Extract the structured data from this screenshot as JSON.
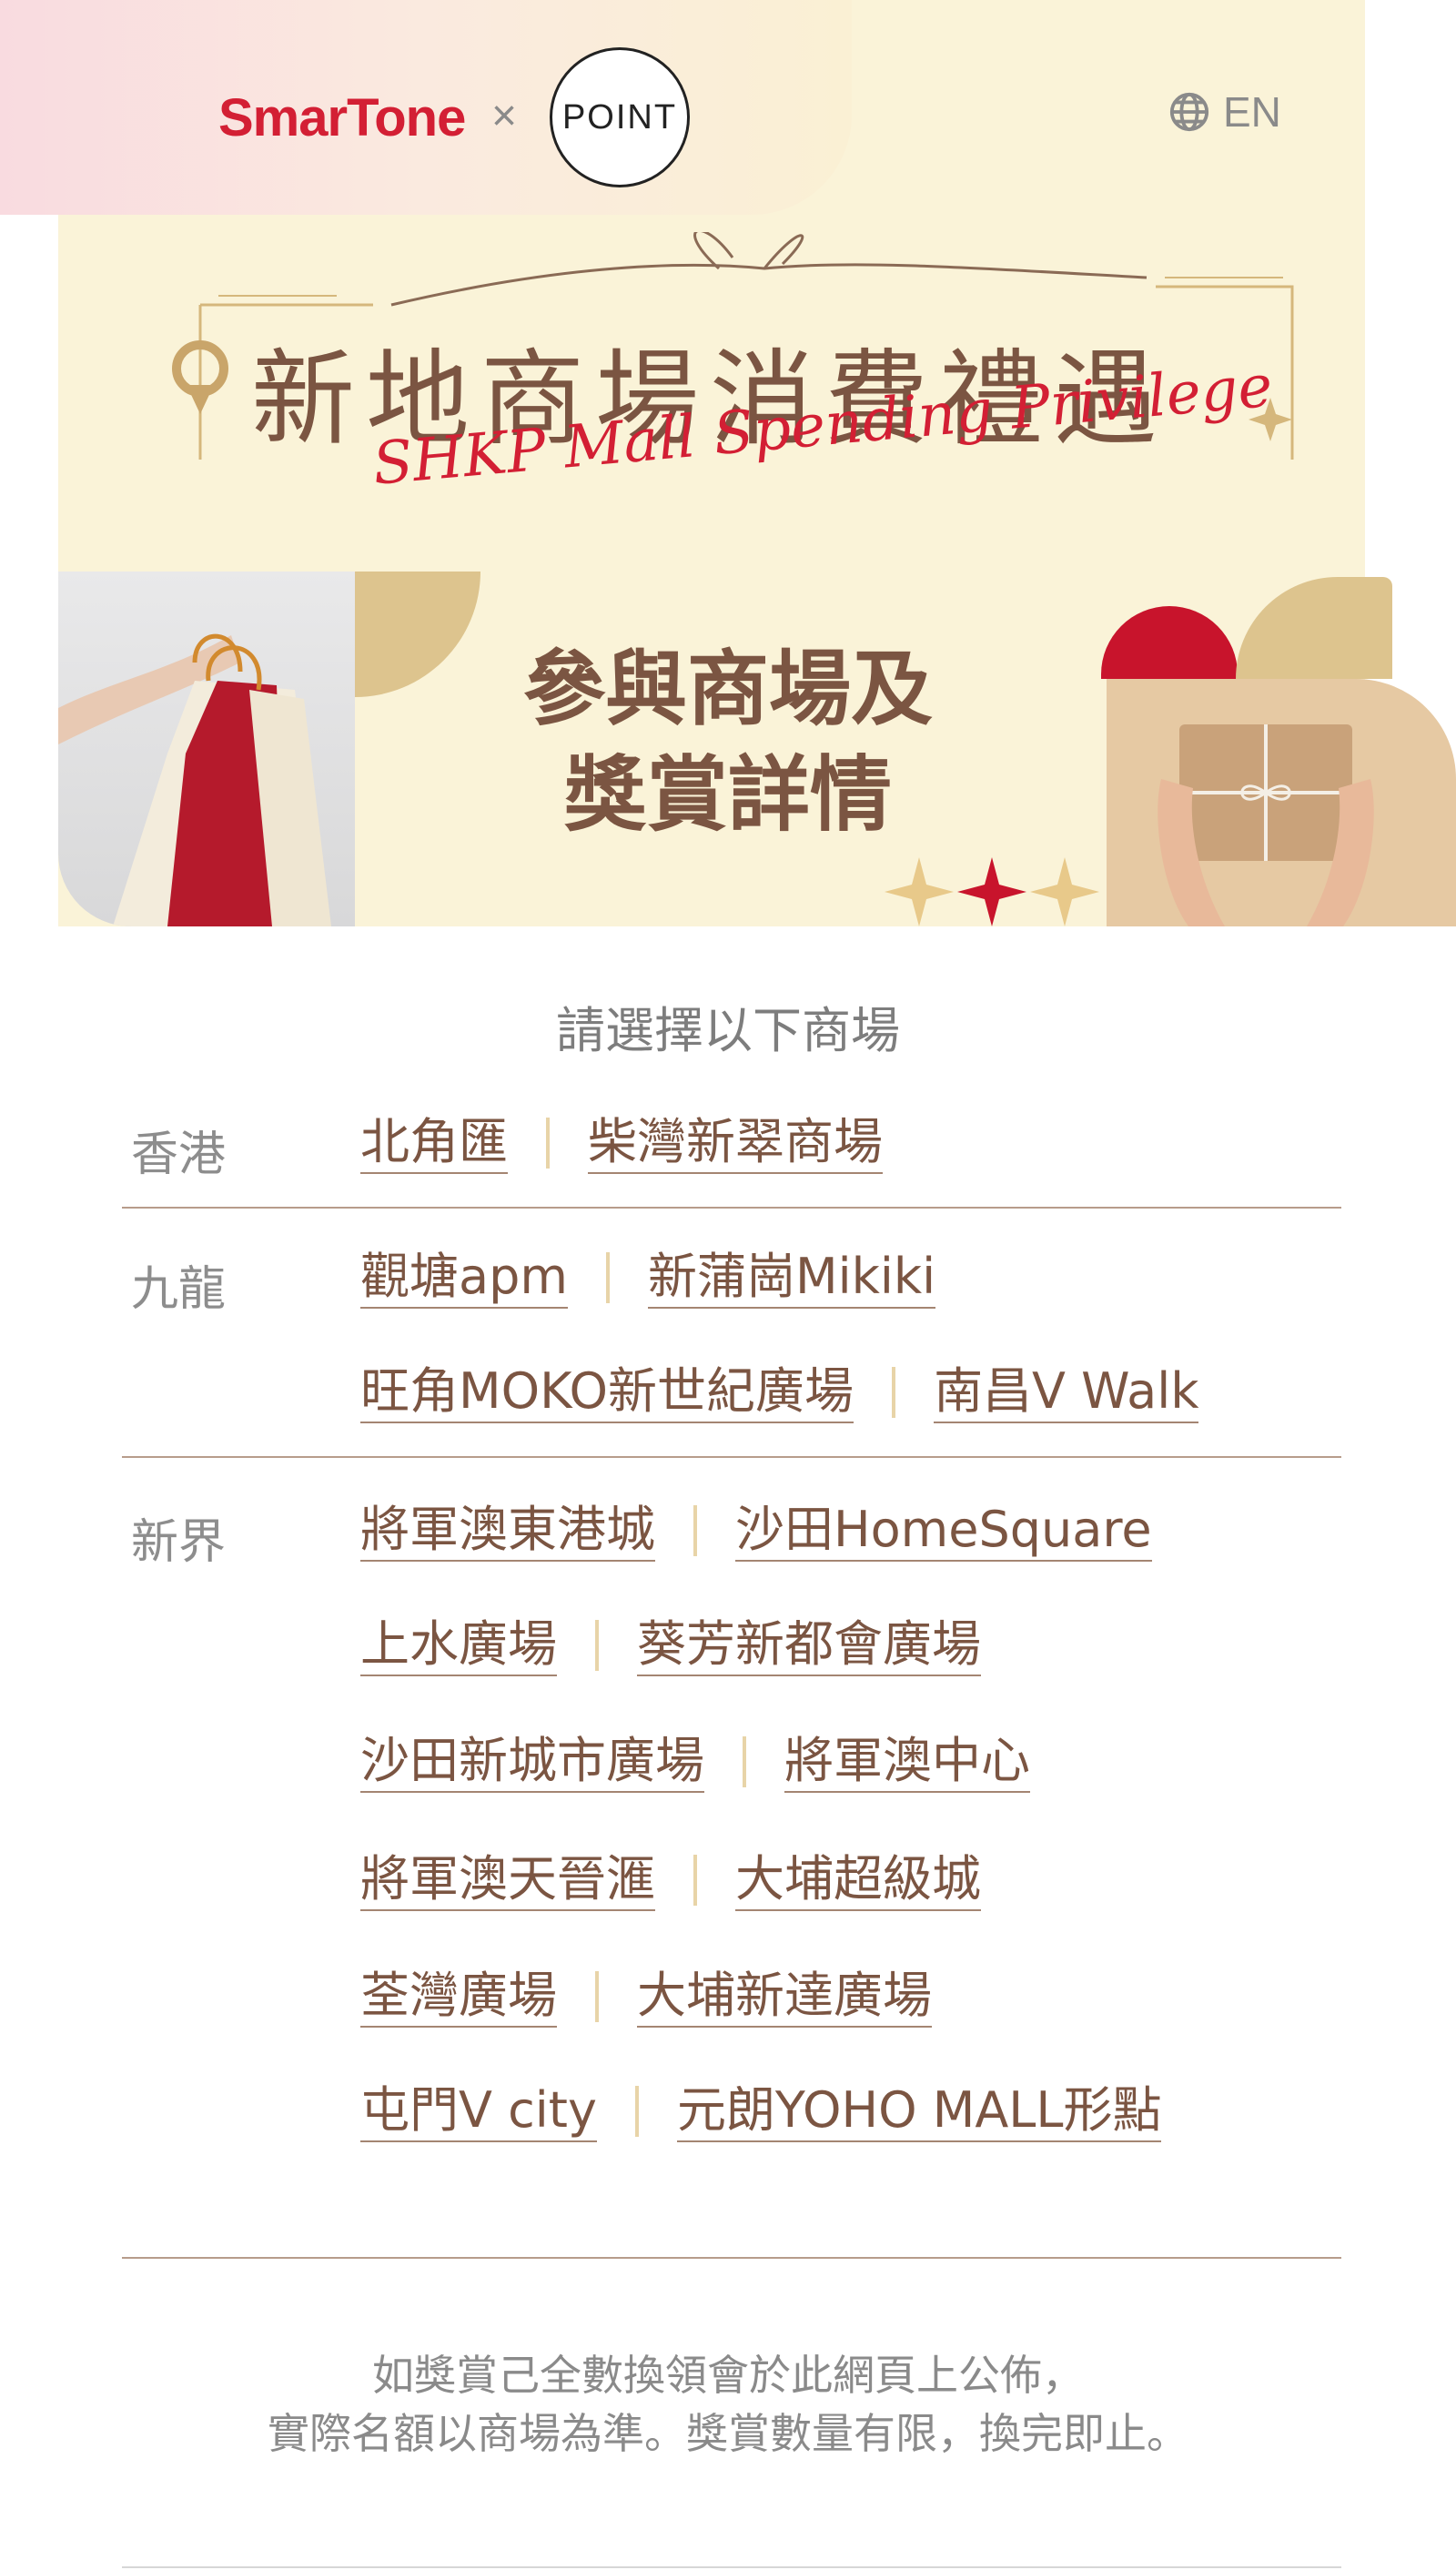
{
  "header": {
    "brand_primary": "SmarTone",
    "brand_separator": "×",
    "brand_partner": "POINT",
    "language_toggle": "EN",
    "language_icon": "globe-icon"
  },
  "hero": {
    "title_zh": "新地商場消費禮遇",
    "title_en": "SHKP Mall Spending Privilege",
    "section_title_line1": "參與商場及",
    "section_title_line2": "獎賞詳情",
    "colors": {
      "accent_red": "#d31f34",
      "gold": "#ddc48e",
      "brown": "#7b5542",
      "cream": "#faf3d8"
    }
  },
  "mall_list": {
    "instruction": "請選擇以下商場",
    "regions": [
      {
        "label": "香港",
        "rows": [
          [
            "北角匯",
            "柴灣新翠商場"
          ]
        ]
      },
      {
        "label": "九龍",
        "rows": [
          [
            "觀塘apm",
            "新蒲崗Mikiki"
          ],
          [
            "旺角MOKO新世紀廣場",
            "南昌V Walk"
          ]
        ]
      },
      {
        "label": "新界",
        "rows": [
          [
            "將軍澳東港城",
            "沙田HomeSquare"
          ],
          [
            "上水廣場",
            "葵芳新都會廣場"
          ],
          [
            "沙田新城市廣場",
            "將軍澳中心"
          ],
          [
            "將軍澳天晉滙",
            "大埔超級城"
          ],
          [
            "荃灣廣場",
            "大埔新達廣場"
          ],
          [
            "屯門V city",
            "元朗YOHO MALL形點"
          ]
        ]
      }
    ]
  },
  "notice": {
    "line1": "如獎賞己全數換領會於此網頁上公佈，",
    "line2": "實際名額以商場為準。獎賞數量有限，換完即止。"
  }
}
